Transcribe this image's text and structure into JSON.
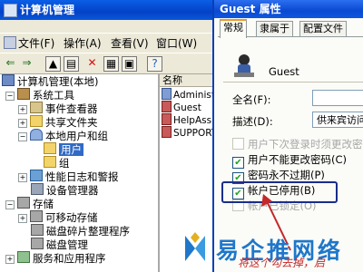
{
  "mmc": {
    "title": "计算机管理",
    "menus": [
      "文件(F)",
      "操作(A)",
      "查看(V)",
      "窗口(W)"
    ],
    "toolbar_icons": [
      "back-icon",
      "forward-icon",
      "up-folder-icon",
      "console-tree-icon",
      "delete-icon",
      "properties-icon",
      "export-icon",
      "help-icon"
    ],
    "tree": [
      {
        "label": "计算机管理(本地)",
        "level": 0,
        "expander": "",
        "icon": "computer-icon"
      },
      {
        "label": "系统工具",
        "level": 1,
        "expander": "-",
        "icon": "tools-icon"
      },
      {
        "label": "事件查看器",
        "level": 2,
        "expander": "+",
        "icon": "event-viewer-icon"
      },
      {
        "label": "共享文件夹",
        "level": 2,
        "expander": "+",
        "icon": "shared-folder-icon"
      },
      {
        "label": "本地用户和组",
        "level": 2,
        "expander": "-",
        "icon": "users-groups-icon"
      },
      {
        "label": "用户",
        "level": 3,
        "expander": "",
        "icon": "folder-icon",
        "selected": true
      },
      {
        "label": "组",
        "level": 3,
        "expander": "",
        "icon": "folder-icon"
      },
      {
        "label": "性能日志和警报",
        "level": 2,
        "expander": "+",
        "icon": "performance-icon"
      },
      {
        "label": "设备管理器",
        "level": 2,
        "expander": "",
        "icon": "device-manager-icon"
      },
      {
        "label": "存储",
        "level": 1,
        "expander": "-",
        "icon": "storage-icon"
      },
      {
        "label": "可移动存储",
        "level": 2,
        "expander": "+",
        "icon": "removable-storage-icon"
      },
      {
        "label": "磁盘碎片整理程序",
        "level": 2,
        "expander": "",
        "icon": "defrag-icon"
      },
      {
        "label": "磁盘管理",
        "level": 2,
        "expander": "",
        "icon": "disk-management-icon"
      },
      {
        "label": "服务和应用程序",
        "level": 1,
        "expander": "+",
        "icon": "services-icon"
      }
    ],
    "list_header": "名称",
    "list_rows": [
      "Administ",
      "Guest",
      "HelpAssi",
      "SUPPORT_"
    ]
  },
  "dialog": {
    "title": "Guest 属性",
    "tabs": [
      "常规",
      "隶属于",
      "配置文件"
    ],
    "active_tab": 0,
    "username": "Guest",
    "fullname_label": "全名(F):",
    "fullname_value": "",
    "description_label": "描述(D):",
    "description_value": "供来宾访问计算",
    "checkboxes": [
      {
        "label": "用户下次登录时须更改密码(M)",
        "checked": false,
        "disabled": true
      },
      {
        "label": "用户不能更改密码(C)",
        "checked": true,
        "disabled": false
      },
      {
        "label": "密码永不过期(P)",
        "checked": true,
        "disabled": false
      },
      {
        "label": "帐户已停用(B)",
        "checked": true,
        "disabled": false
      },
      {
        "label": "帐户已锁定(O)",
        "checked": false,
        "disabled": true
      }
    ]
  },
  "watermark": {
    "logo_text": "易企推网络",
    "note": "将这个勾去掉，启"
  },
  "colors": {
    "title_blue": "#0441c8",
    "selection": "#316ac5",
    "check_green": "#21a121",
    "annotation_red": "#c3282a",
    "highlight_box": "#1a2d8a"
  }
}
